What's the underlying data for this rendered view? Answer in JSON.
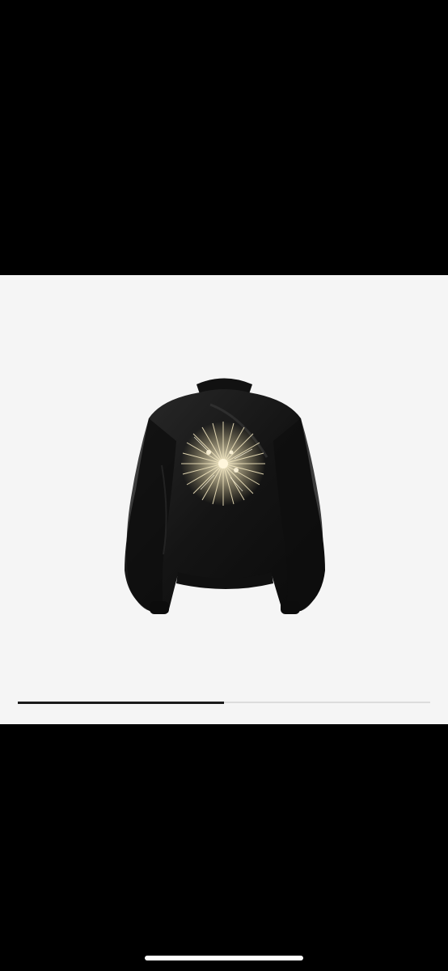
{
  "viewer": {
    "background": "#f5f5f5",
    "image_icon": "bomber-jacket-with-embroidered-firework",
    "slide_progress": 0.5,
    "progress_fill_color": "#1a1a1a",
    "progress_track_color": "#dcdcdc"
  },
  "chrome": {
    "letterbox_color": "#000000",
    "home_indicator_color": "#ffffff"
  }
}
